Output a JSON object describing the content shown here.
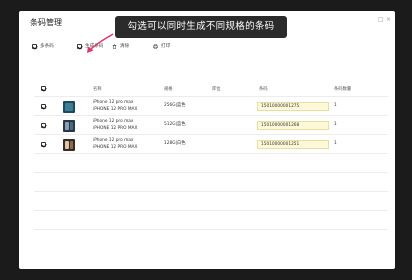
{
  "window": {
    "title": "条码管理",
    "controls": [
      "□",
      "×"
    ]
  },
  "callout": {
    "text": "勾选可以同时生成不同规格的条码"
  },
  "toolbar": {
    "multi_select_label": "多条码",
    "generate_label": "生成条码",
    "clear_label": "清除",
    "print_label": "打印"
  },
  "table": {
    "headers": {
      "name": "名称",
      "spec": "规格",
      "stock": "库位",
      "barcode": "条码",
      "qty": "条码数量"
    },
    "rows": [
      {
        "checked": true,
        "name": "iPhone 12 pro max",
        "name_sub": "iPHONE 12 PRO MAX",
        "spec": "256G|蓝色",
        "barcode": "15010000001275",
        "qty": "1",
        "thumb_color": "#1f4a5e"
      },
      {
        "checked": true,
        "name": "iPhone 12 pro max",
        "name_sub": "iPHONE 12 PRO MAX",
        "spec": "512G|蓝色",
        "barcode": "15010000001268",
        "qty": "1",
        "thumb_color": "#26384a"
      },
      {
        "checked": true,
        "name": "iPhone 12 pro max",
        "name_sub": "iPHONE 12 PRO MAX",
        "spec": "128G|白色",
        "barcode": "15010000001251",
        "qty": "1",
        "thumb_color": "#3b2a22"
      }
    ]
  },
  "colors": {
    "overlay": "#1b1b1b",
    "callout_bg": "#2b2b2b",
    "barcode_bg": "#fdf9d8",
    "arrow": "#e0336a"
  }
}
